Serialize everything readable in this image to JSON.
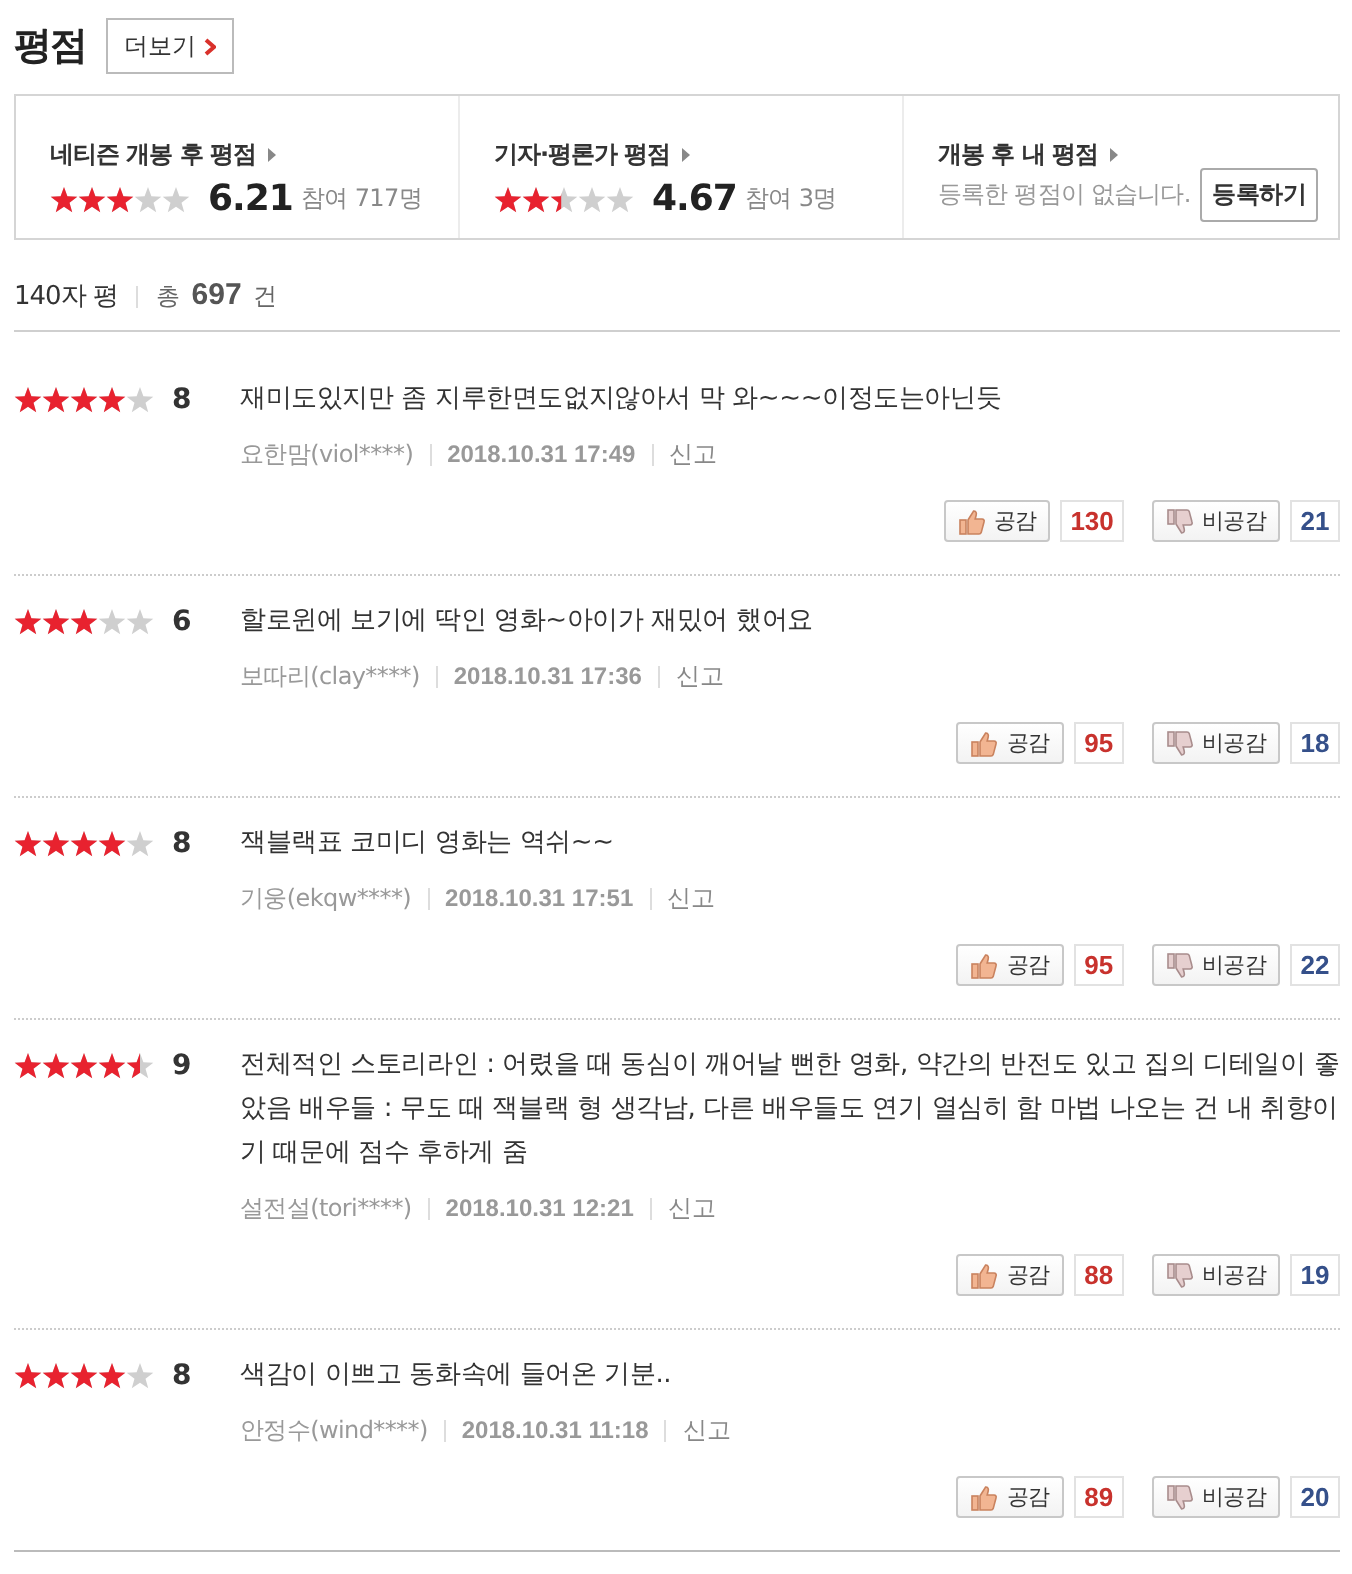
{
  "header": {
    "title": "평점",
    "more_button": "더보기"
  },
  "summary": [
    {
      "kind": "score",
      "title": "네티즌 개봉 후 평점",
      "stars": 3,
      "score": "6.21",
      "participants": "참여 717명"
    },
    {
      "kind": "score",
      "title": "기자·평론가 평점",
      "stars": 2.4,
      "score": "4.67",
      "participants": "참여 3명"
    },
    {
      "kind": "mine",
      "title": "개봉 후 내 평점",
      "message": "등록한 평점이 없습니다.",
      "button": "등록하기"
    }
  ],
  "list_header": {
    "label": "140자 평",
    "total": "총 **697** 건"
  },
  "reviews": [
    {
      "stars": 4,
      "score": "8",
      "text": "재미도있지만 좀 지루한면도없지않아서 막 와~~~이정도는아닌듯",
      "author": "요한맘(viol****)",
      "date": "2018.10.31 17:49",
      "report": "신고",
      "like_label": "공감",
      "likes": "130",
      "dislike_label": "비공감",
      "dislikes": "21"
    },
    {
      "stars": 3,
      "score": "6",
      "text": "할로윈에 보기에 딱인 영화~아이가 재밌어 했어요",
      "author": "보따리(clay****)",
      "date": "2018.10.31 17:36",
      "report": "신고",
      "like_label": "공감",
      "likes": "95",
      "dislike_label": "비공감",
      "dislikes": "18"
    },
    {
      "stars": 4,
      "score": "8",
      "text": "잭블랙표 코미디 영화는 역쉬~~",
      "author": "기웅(ekqw****)",
      "date": "2018.10.31 17:51",
      "report": "신고",
      "like_label": "공감",
      "likes": "95",
      "dislike_label": "비공감",
      "dislikes": "22"
    },
    {
      "stars": 4.5,
      "score": "9",
      "text": "전체적인 스토리라인 : 어렸을 때 동심이 깨어날 뻔한 영화, 약간의 반전도 있고 집의 디테일이 좋았음 배우들 : 무도 때 잭블랙 형 생각남, 다른 배우들도 연기 열심히 함 마법 나오는 건 내 취향이기 때문에 점수 후하게 줌",
      "author": "설전설(tori****)",
      "date": "2018.10.31 12:21",
      "report": "신고",
      "like_label": "공감",
      "likes": "88",
      "dislike_label": "비공감",
      "dislikes": "19"
    },
    {
      "stars": 4,
      "score": "8",
      "text": "색감이 이쁘고 동화속에 들어온 기분..",
      "author": "안정수(wind****)",
      "date": "2018.10.31 11:18",
      "report": "신고",
      "like_label": "공감",
      "likes": "89",
      "dislike_label": "비공감",
      "dislikes": "20"
    }
  ]
}
